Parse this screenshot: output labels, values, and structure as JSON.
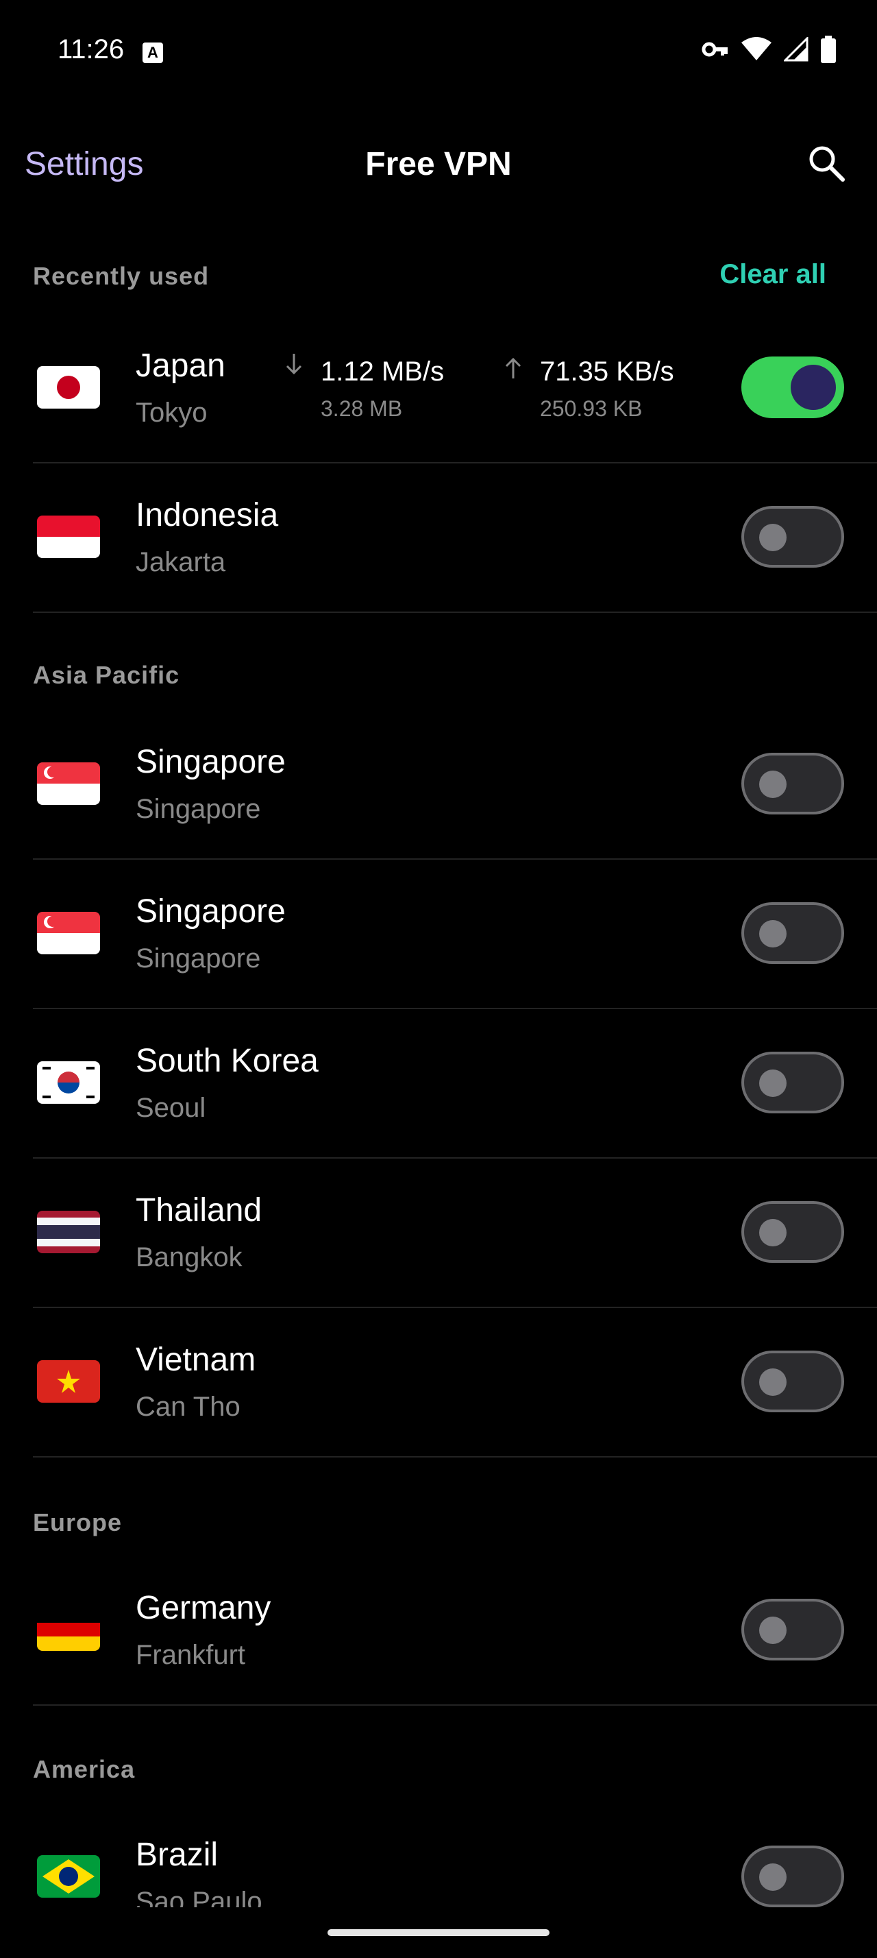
{
  "status_bar": {
    "time": "11:26",
    "a_icon_letter": "A"
  },
  "app_bar": {
    "settings_label": "Settings",
    "title": "Free VPN"
  },
  "recent": {
    "header": "Recently used",
    "clear_all": "Clear all",
    "items": [
      {
        "country": "Japan",
        "city": "Tokyo",
        "flag": "japan-flag",
        "on": true,
        "down_rate": "1.12 MB/s",
        "down_total": "3.28 MB",
        "up_rate": "71.35 KB/s",
        "up_total": "250.93 KB"
      },
      {
        "country": "Indonesia",
        "city": "Jakarta",
        "flag": "indonesia-flag",
        "on": false
      }
    ]
  },
  "asia": {
    "header": "Asia Pacific",
    "items": [
      {
        "country": "Singapore",
        "city": "Singapore",
        "flag": "singapore-flag",
        "on": false
      },
      {
        "country": "Singapore",
        "city": "Singapore",
        "flag": "singapore-flag",
        "on": false
      },
      {
        "country": "South Korea",
        "city": "Seoul",
        "flag": "south-korea-flag",
        "on": false
      },
      {
        "country": "Thailand",
        "city": "Bangkok",
        "flag": "thailand-flag",
        "on": false
      },
      {
        "country": "Vietnam",
        "city": "Can Tho",
        "flag": "vietnam-flag",
        "on": false
      }
    ]
  },
  "europe": {
    "header": "Europe",
    "items": [
      {
        "country": "Germany",
        "city": "Frankfurt",
        "flag": "germany-flag",
        "on": false
      }
    ]
  },
  "america": {
    "header": "America",
    "items": [
      {
        "country": "Brazil",
        "city": "Sao Paulo",
        "flag": "brazil-flag",
        "on": false
      }
    ]
  },
  "colors": {
    "accent_green": "#39d159",
    "accent_teal": "#2fd0b3",
    "settings_lavender": "#c6b9f5"
  }
}
